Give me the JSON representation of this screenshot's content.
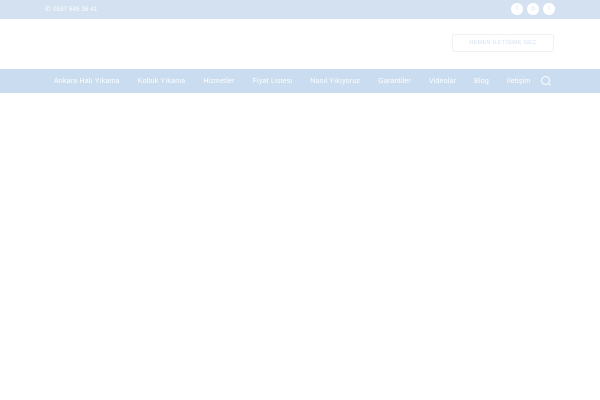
{
  "topbar": {
    "phone_icon": "phone-icon",
    "phone": "0537 645 36 41",
    "social": [
      {
        "icon": "facebook-icon",
        "glyph": "f"
      },
      {
        "icon": "instagram-icon",
        "glyph": "◎"
      },
      {
        "icon": "twitter-icon",
        "glyph": "t"
      }
    ]
  },
  "header": {
    "cta_label": "HEMEN İLETİŞİME GEÇ"
  },
  "nav": {
    "items": [
      "Ankara Halı Yıkama",
      "Koltuk Yıkama",
      "Hizmetler",
      "Fiyat Listesi",
      "Nasıl Yıkıyoruz",
      "Garantiler",
      "Videolar",
      "Blog",
      "İletişim"
    ],
    "active_index": 0,
    "search_icon": "search-icon"
  },
  "colors": {
    "topbar": "#d3e1f1",
    "nav": "#cadcf0",
    "text_light": "#ffffff"
  }
}
